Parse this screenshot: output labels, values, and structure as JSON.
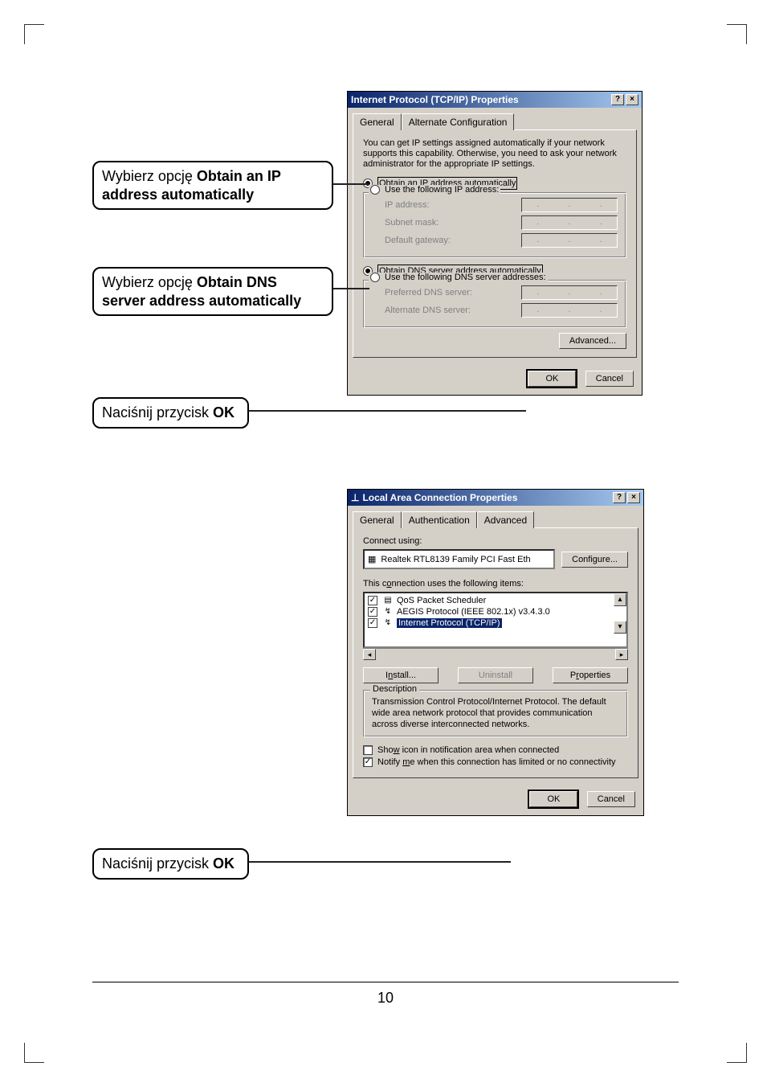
{
  "page_number": "10",
  "callouts": {
    "c1_pre": "Wybierz opcję ",
    "c1_bold": "Obtain an IP address automatically",
    "c2_pre": "Wybierz opcję ",
    "c2_bold": "Obtain DNS server address automatically",
    "c3_pre": "Naciśnij przycisk ",
    "c3_bold": "OK",
    "c4_pre": "Naciśnij przycisk ",
    "c4_bold": "OK"
  },
  "dlg1": {
    "title": "Internet Protocol (TCP/IP) Properties",
    "tabs": {
      "general": "General",
      "alt": "Alternate Configuration"
    },
    "info": "You can get IP settings assigned automatically if your network supports this capability. Otherwise, you need to ask your network administrator for the appropriate IP settings.",
    "radio_ip_auto": "Obtain an IP address automatically",
    "radio_ip_manual": "Use the following IP address:",
    "field_ip": "IP address:",
    "field_mask": "Subnet mask:",
    "field_gateway": "Default gateway:",
    "radio_dns_auto": "Obtain DNS server address automatically",
    "radio_dns_manual": "Use the following DNS server addresses:",
    "field_dns1": "Preferred DNS server:",
    "field_dns2": "Alternate DNS server:",
    "advanced": "Advanced...",
    "ok": "OK",
    "cancel": "Cancel"
  },
  "dlg2": {
    "title": "Local Area Connection   Properties",
    "tabs": {
      "general": "General",
      "auth": "Authentication",
      "adv": "Advanced"
    },
    "connect_using": "Connect using:",
    "adapter": "Realtek RTL8139 Family PCI Fast Eth",
    "configure": "Configure...",
    "items_label": "This connection uses the following items:",
    "items": [
      "QoS Packet Scheduler",
      "AEGIS Protocol (IEEE 802.1x) v3.4.3.0",
      "Internet Protocol (TCP/IP)"
    ],
    "install": "Install...",
    "uninstall": "Uninstall",
    "properties": "Properties",
    "desc_title": "Description",
    "desc_text": "Transmission Control Protocol/Internet Protocol. The default wide area network protocol that provides communication across diverse interconnected networks.",
    "show_icon": "Show icon in notification area when connected",
    "notify": "Notify me when this connection has limited or no connectivity",
    "ok": "OK",
    "cancel": "Cancel"
  }
}
